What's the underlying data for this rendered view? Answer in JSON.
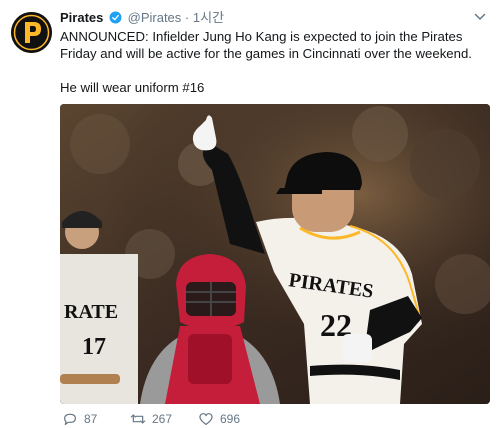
{
  "account": {
    "name": "Pirates",
    "handle": "@Pirates",
    "separator": "·",
    "time": "1시간",
    "avatar_icon": "pirates-p-logo-icon",
    "verified_icon": "verified-badge-icon"
  },
  "tweet": {
    "paragraphs": [
      "ANNOUNCED: Infielder Jung Ho Kang is expected to join the Pirates Friday and will be active for the games in Cincinnati over the weekend.",
      "He will wear uniform #16"
    ]
  },
  "photo": {
    "jersey_text": "PIRATES",
    "jersey_number": "22",
    "left_player_text": "RATE",
    "left_player_number": "17"
  },
  "actions": {
    "reply_count": "87",
    "retweet_count": "267",
    "like_count": "696"
  },
  "colors": {
    "pirates_gold": "#fdb827",
    "pirates_black": "#111111",
    "cardinals_red": "#c41e3a",
    "verified_blue": "#1da1f2",
    "muted_text": "#657786"
  }
}
